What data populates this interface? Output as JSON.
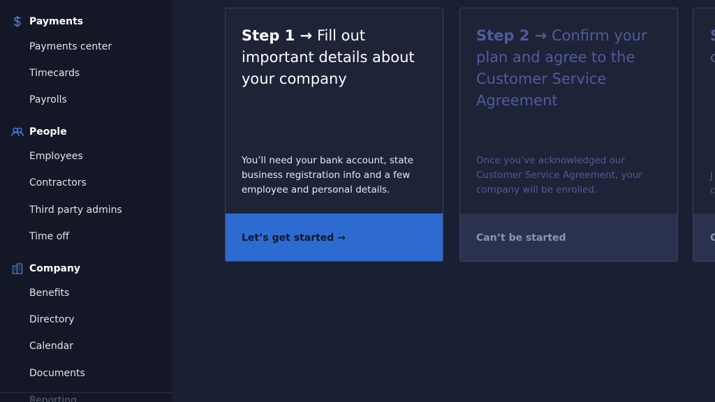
{
  "sidebar": {
    "payments": {
      "header": "Payments",
      "items": [
        "Payments center",
        "Timecards",
        "Payrolls"
      ]
    },
    "people": {
      "header": "People",
      "items": [
        "Employees",
        "Contractors",
        "Third party admins",
        "Time off"
      ]
    },
    "company": {
      "header": "Company",
      "items": [
        "Benefits",
        "Directory",
        "Calendar",
        "Documents"
      ]
    },
    "cut_off_item": "Reporting"
  },
  "steps": [
    {
      "step_label": "Step 1 →",
      "title": " Fill out important details about your company",
      "description": "You’ll need your bank account, state business registration info and a few employee and personal details.",
      "action": "Let’s get started →",
      "state": "active"
    },
    {
      "step_label": "Step 2 →",
      "title": " Confirm your plan and agree to the Customer Service Agreement",
      "description": "Once you’ve acknowledged our Customer Service Agreement, your company will be enrolled.",
      "action": "Can’t be started",
      "state": "disabled"
    },
    {
      "step_label": "S",
      "title": "",
      "line2": "c",
      "desc1": "J",
      "desc2": "c",
      "action": "C",
      "state": "disabled"
    }
  ],
  "colors": {
    "accent": "#2d6bd0",
    "background": "#1b1f33",
    "sidebar": "#141826",
    "muted_text": "#4f5d99"
  },
  "icons": {
    "payments": "dollar-icon",
    "people": "people-icon",
    "company": "building-icon"
  }
}
